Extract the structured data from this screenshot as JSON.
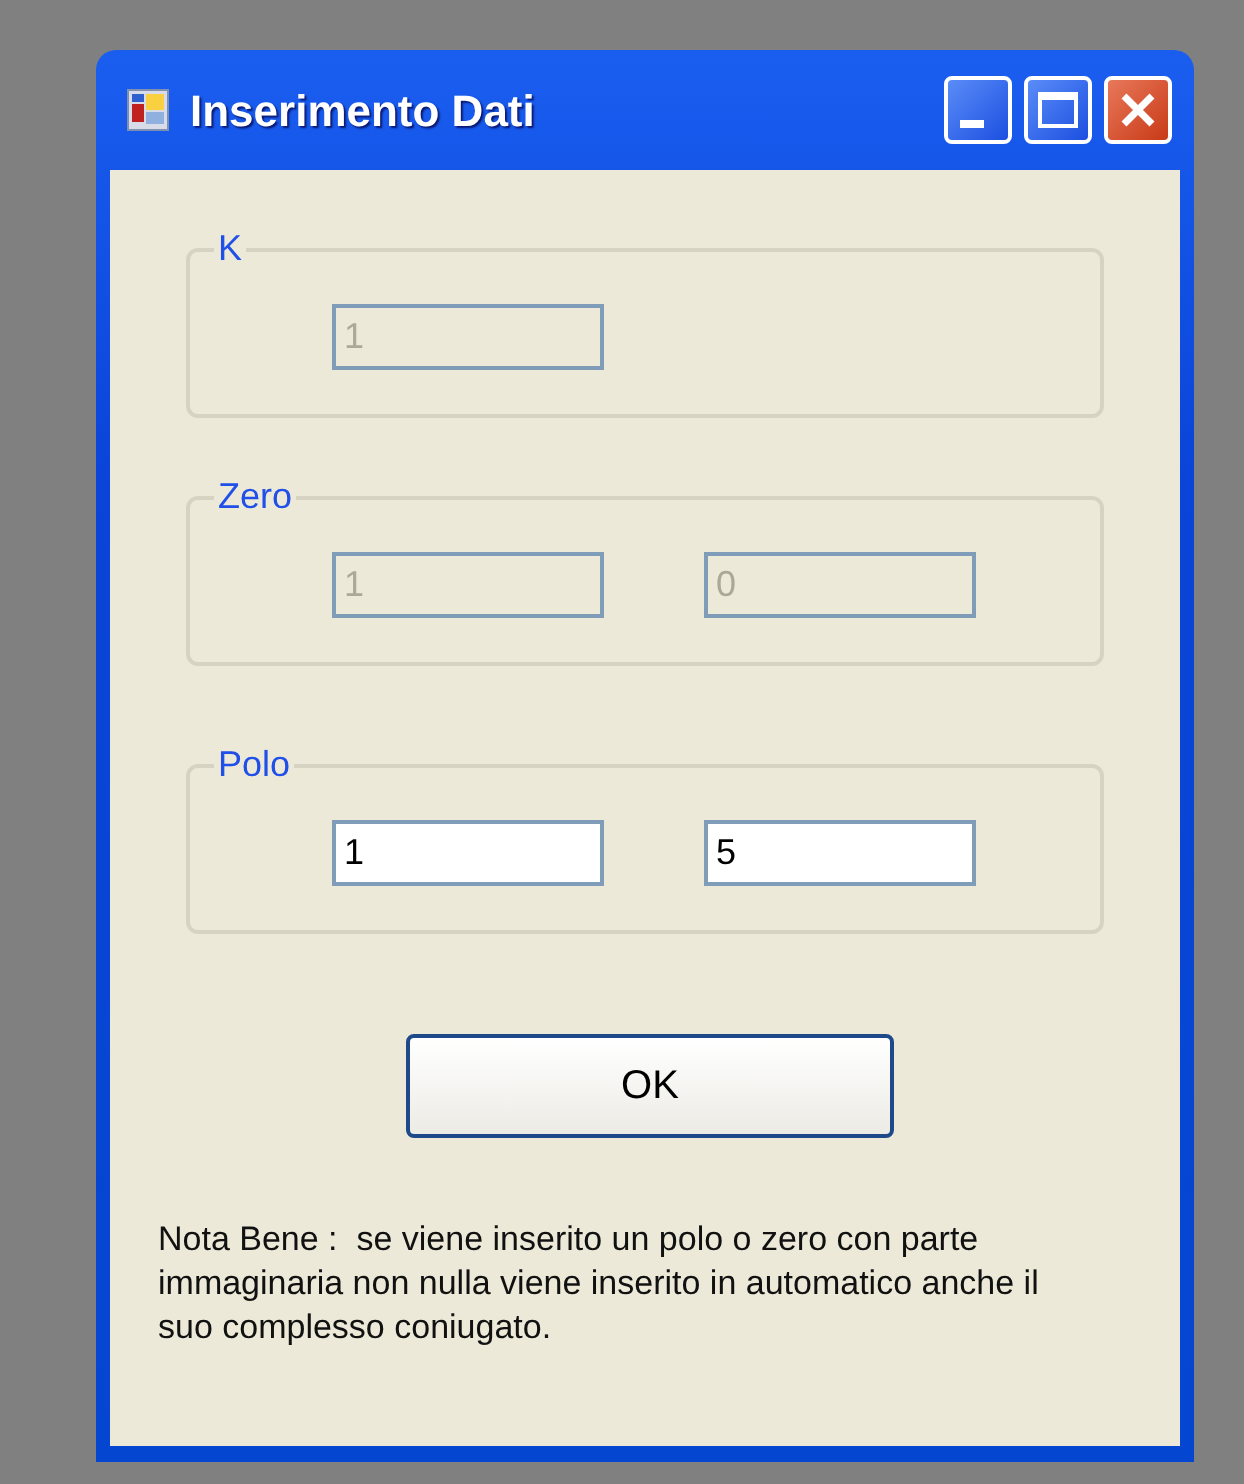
{
  "window": {
    "title": "Inserimento Dati"
  },
  "groups": [
    {
      "title": "K",
      "fields": [
        {
          "value": "1",
          "disabled": true
        }
      ]
    },
    {
      "title": "Zero",
      "fields": [
        {
          "value": "1",
          "disabled": true
        },
        {
          "value": "0",
          "disabled": true
        }
      ]
    },
    {
      "title": "Polo",
      "fields": [
        {
          "value": "1",
          "disabled": false
        },
        {
          "value": "5",
          "disabled": false
        }
      ]
    }
  ],
  "ok_button": "OK",
  "note": "Nota Bene :  se viene inserito un polo o zero con parte immaginaria non nulla viene inserito in automatico anche il suo complesso coniugato."
}
